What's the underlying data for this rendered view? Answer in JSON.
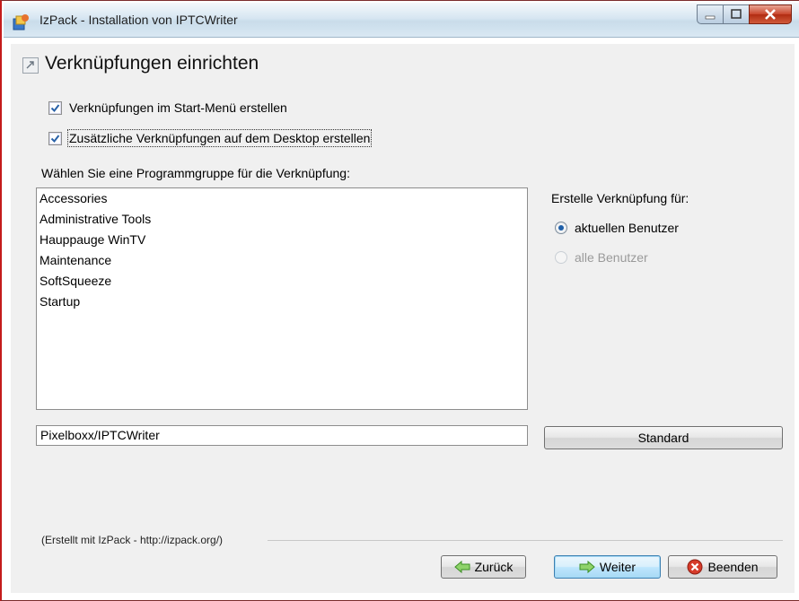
{
  "window": {
    "title": "IzPack - Installation von IPTCWriter",
    "controls": {
      "minimize": "minimize-icon",
      "maximize": "maximize-icon",
      "close": "close-icon"
    }
  },
  "header": {
    "title": "Verknüpfungen einrichten",
    "icon": "shortcut-icon"
  },
  "options": {
    "start_menu": {
      "label": "Verknüpfungen im Start-Menü erstellen",
      "checked": true
    },
    "desktop": {
      "label": "Zusätzliche Verknüpfungen auf dem Desktop erstellen",
      "checked": true
    }
  },
  "program_group": {
    "label": "Wählen Sie eine Programmgruppe für die Verknüpfung:",
    "items": [
      "Accessories",
      "Administrative Tools",
      "Hauppauge WinTV",
      "Maintenance",
      "SoftSqueeze",
      "Startup"
    ],
    "path_value": "Pixelboxx/IPTCWriter",
    "default_button": "Standard"
  },
  "create_for": {
    "label": "Erstelle Verknüpfung für:",
    "options": [
      {
        "label": "aktuellen Benutzer",
        "selected": true,
        "enabled": true
      },
      {
        "label": "alle Benutzer",
        "selected": false,
        "enabled": false
      }
    ]
  },
  "footer": {
    "credit": "(Erstellt mit IzPack - http://izpack.org/)",
    "back": "Zurück",
    "next": "Weiter",
    "quit": "Beenden"
  },
  "colors": {
    "accent": "#3c7fb1",
    "close_red": "#c8452b"
  }
}
